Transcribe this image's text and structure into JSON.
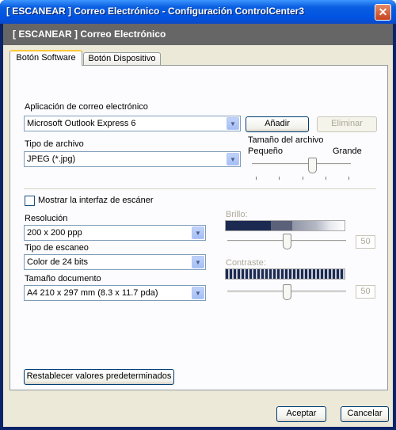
{
  "window": {
    "title": "[ ESCANEAR ]   Correo Electrónico - Configuración ControlCenter3",
    "close_glyph": "✕"
  },
  "banner": {
    "text": "[ ESCANEAR ]   Correo Electrónico"
  },
  "tabs": [
    {
      "label": "Botón Software",
      "selected": true
    },
    {
      "label": "Botón Dispositivo",
      "selected": false
    }
  ],
  "email_app": {
    "label": "Aplicación de correo electrónico",
    "value": "Microsoft Outlook Express 6",
    "add_button": "Añadir",
    "remove_button": "Eliminar"
  },
  "file_type": {
    "label": "Tipo de archivo",
    "value": "JPEG (*.jpg)"
  },
  "file_size": {
    "label": "Tamaño del archivo",
    "min_label": "Pequeño",
    "max_label": "Grande",
    "level": 0.75
  },
  "show_scanner_interface": {
    "label": "Mostrar la interfaz de escáner",
    "checked": false
  },
  "resolution": {
    "label": "Resolución",
    "value": "200 x 200 ppp"
  },
  "scan_type": {
    "label": "Tipo de escaneo",
    "value": "Color de 24 bits"
  },
  "doc_size": {
    "label": "Tamaño documento",
    "value": "A4 210 x 297 mm (8.3 x 11.7 pda)"
  },
  "brightness": {
    "label": "Brillo:",
    "value": "50"
  },
  "contrast": {
    "label": "Contraste:",
    "value": "50"
  },
  "reset_button": "Restablecer valores predeterminados",
  "footer": {
    "accept": "Aceptar",
    "cancel": "Cancelar"
  },
  "icons": {
    "dropdown": "▼"
  },
  "colors": {
    "title_bar": "#0054e3",
    "banner": "#666666",
    "dialog_bg": "#ece9d8",
    "tab_highlight": "#ffc83c"
  }
}
